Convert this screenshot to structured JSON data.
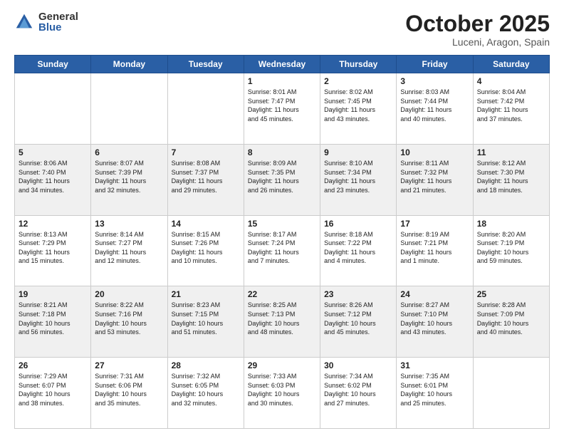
{
  "logo": {
    "general": "General",
    "blue": "Blue"
  },
  "header": {
    "month": "October 2025",
    "location": "Luceni, Aragon, Spain"
  },
  "days_of_week": [
    "Sunday",
    "Monday",
    "Tuesday",
    "Wednesday",
    "Thursday",
    "Friday",
    "Saturday"
  ],
  "weeks": [
    [
      {
        "day": "",
        "info": ""
      },
      {
        "day": "",
        "info": ""
      },
      {
        "day": "",
        "info": ""
      },
      {
        "day": "1",
        "info": "Sunrise: 8:01 AM\nSunset: 7:47 PM\nDaylight: 11 hours\nand 45 minutes."
      },
      {
        "day": "2",
        "info": "Sunrise: 8:02 AM\nSunset: 7:45 PM\nDaylight: 11 hours\nand 43 minutes."
      },
      {
        "day": "3",
        "info": "Sunrise: 8:03 AM\nSunset: 7:44 PM\nDaylight: 11 hours\nand 40 minutes."
      },
      {
        "day": "4",
        "info": "Sunrise: 8:04 AM\nSunset: 7:42 PM\nDaylight: 11 hours\nand 37 minutes."
      }
    ],
    [
      {
        "day": "5",
        "info": "Sunrise: 8:06 AM\nSunset: 7:40 PM\nDaylight: 11 hours\nand 34 minutes."
      },
      {
        "day": "6",
        "info": "Sunrise: 8:07 AM\nSunset: 7:39 PM\nDaylight: 11 hours\nand 32 minutes."
      },
      {
        "day": "7",
        "info": "Sunrise: 8:08 AM\nSunset: 7:37 PM\nDaylight: 11 hours\nand 29 minutes."
      },
      {
        "day": "8",
        "info": "Sunrise: 8:09 AM\nSunset: 7:35 PM\nDaylight: 11 hours\nand 26 minutes."
      },
      {
        "day": "9",
        "info": "Sunrise: 8:10 AM\nSunset: 7:34 PM\nDaylight: 11 hours\nand 23 minutes."
      },
      {
        "day": "10",
        "info": "Sunrise: 8:11 AM\nSunset: 7:32 PM\nDaylight: 11 hours\nand 21 minutes."
      },
      {
        "day": "11",
        "info": "Sunrise: 8:12 AM\nSunset: 7:30 PM\nDaylight: 11 hours\nand 18 minutes."
      }
    ],
    [
      {
        "day": "12",
        "info": "Sunrise: 8:13 AM\nSunset: 7:29 PM\nDaylight: 11 hours\nand 15 minutes."
      },
      {
        "day": "13",
        "info": "Sunrise: 8:14 AM\nSunset: 7:27 PM\nDaylight: 11 hours\nand 12 minutes."
      },
      {
        "day": "14",
        "info": "Sunrise: 8:15 AM\nSunset: 7:26 PM\nDaylight: 11 hours\nand 10 minutes."
      },
      {
        "day": "15",
        "info": "Sunrise: 8:17 AM\nSunset: 7:24 PM\nDaylight: 11 hours\nand 7 minutes."
      },
      {
        "day": "16",
        "info": "Sunrise: 8:18 AM\nSunset: 7:22 PM\nDaylight: 11 hours\nand 4 minutes."
      },
      {
        "day": "17",
        "info": "Sunrise: 8:19 AM\nSunset: 7:21 PM\nDaylight: 11 hours\nand 1 minute."
      },
      {
        "day": "18",
        "info": "Sunrise: 8:20 AM\nSunset: 7:19 PM\nDaylight: 10 hours\nand 59 minutes."
      }
    ],
    [
      {
        "day": "19",
        "info": "Sunrise: 8:21 AM\nSunset: 7:18 PM\nDaylight: 10 hours\nand 56 minutes."
      },
      {
        "day": "20",
        "info": "Sunrise: 8:22 AM\nSunset: 7:16 PM\nDaylight: 10 hours\nand 53 minutes."
      },
      {
        "day": "21",
        "info": "Sunrise: 8:23 AM\nSunset: 7:15 PM\nDaylight: 10 hours\nand 51 minutes."
      },
      {
        "day": "22",
        "info": "Sunrise: 8:25 AM\nSunset: 7:13 PM\nDaylight: 10 hours\nand 48 minutes."
      },
      {
        "day": "23",
        "info": "Sunrise: 8:26 AM\nSunset: 7:12 PM\nDaylight: 10 hours\nand 45 minutes."
      },
      {
        "day": "24",
        "info": "Sunrise: 8:27 AM\nSunset: 7:10 PM\nDaylight: 10 hours\nand 43 minutes."
      },
      {
        "day": "25",
        "info": "Sunrise: 8:28 AM\nSunset: 7:09 PM\nDaylight: 10 hours\nand 40 minutes."
      }
    ],
    [
      {
        "day": "26",
        "info": "Sunrise: 7:29 AM\nSunset: 6:07 PM\nDaylight: 10 hours\nand 38 minutes."
      },
      {
        "day": "27",
        "info": "Sunrise: 7:31 AM\nSunset: 6:06 PM\nDaylight: 10 hours\nand 35 minutes."
      },
      {
        "day": "28",
        "info": "Sunrise: 7:32 AM\nSunset: 6:05 PM\nDaylight: 10 hours\nand 32 minutes."
      },
      {
        "day": "29",
        "info": "Sunrise: 7:33 AM\nSunset: 6:03 PM\nDaylight: 10 hours\nand 30 minutes."
      },
      {
        "day": "30",
        "info": "Sunrise: 7:34 AM\nSunset: 6:02 PM\nDaylight: 10 hours\nand 27 minutes."
      },
      {
        "day": "31",
        "info": "Sunrise: 7:35 AM\nSunset: 6:01 PM\nDaylight: 10 hours\nand 25 minutes."
      },
      {
        "day": "",
        "info": ""
      }
    ]
  ]
}
